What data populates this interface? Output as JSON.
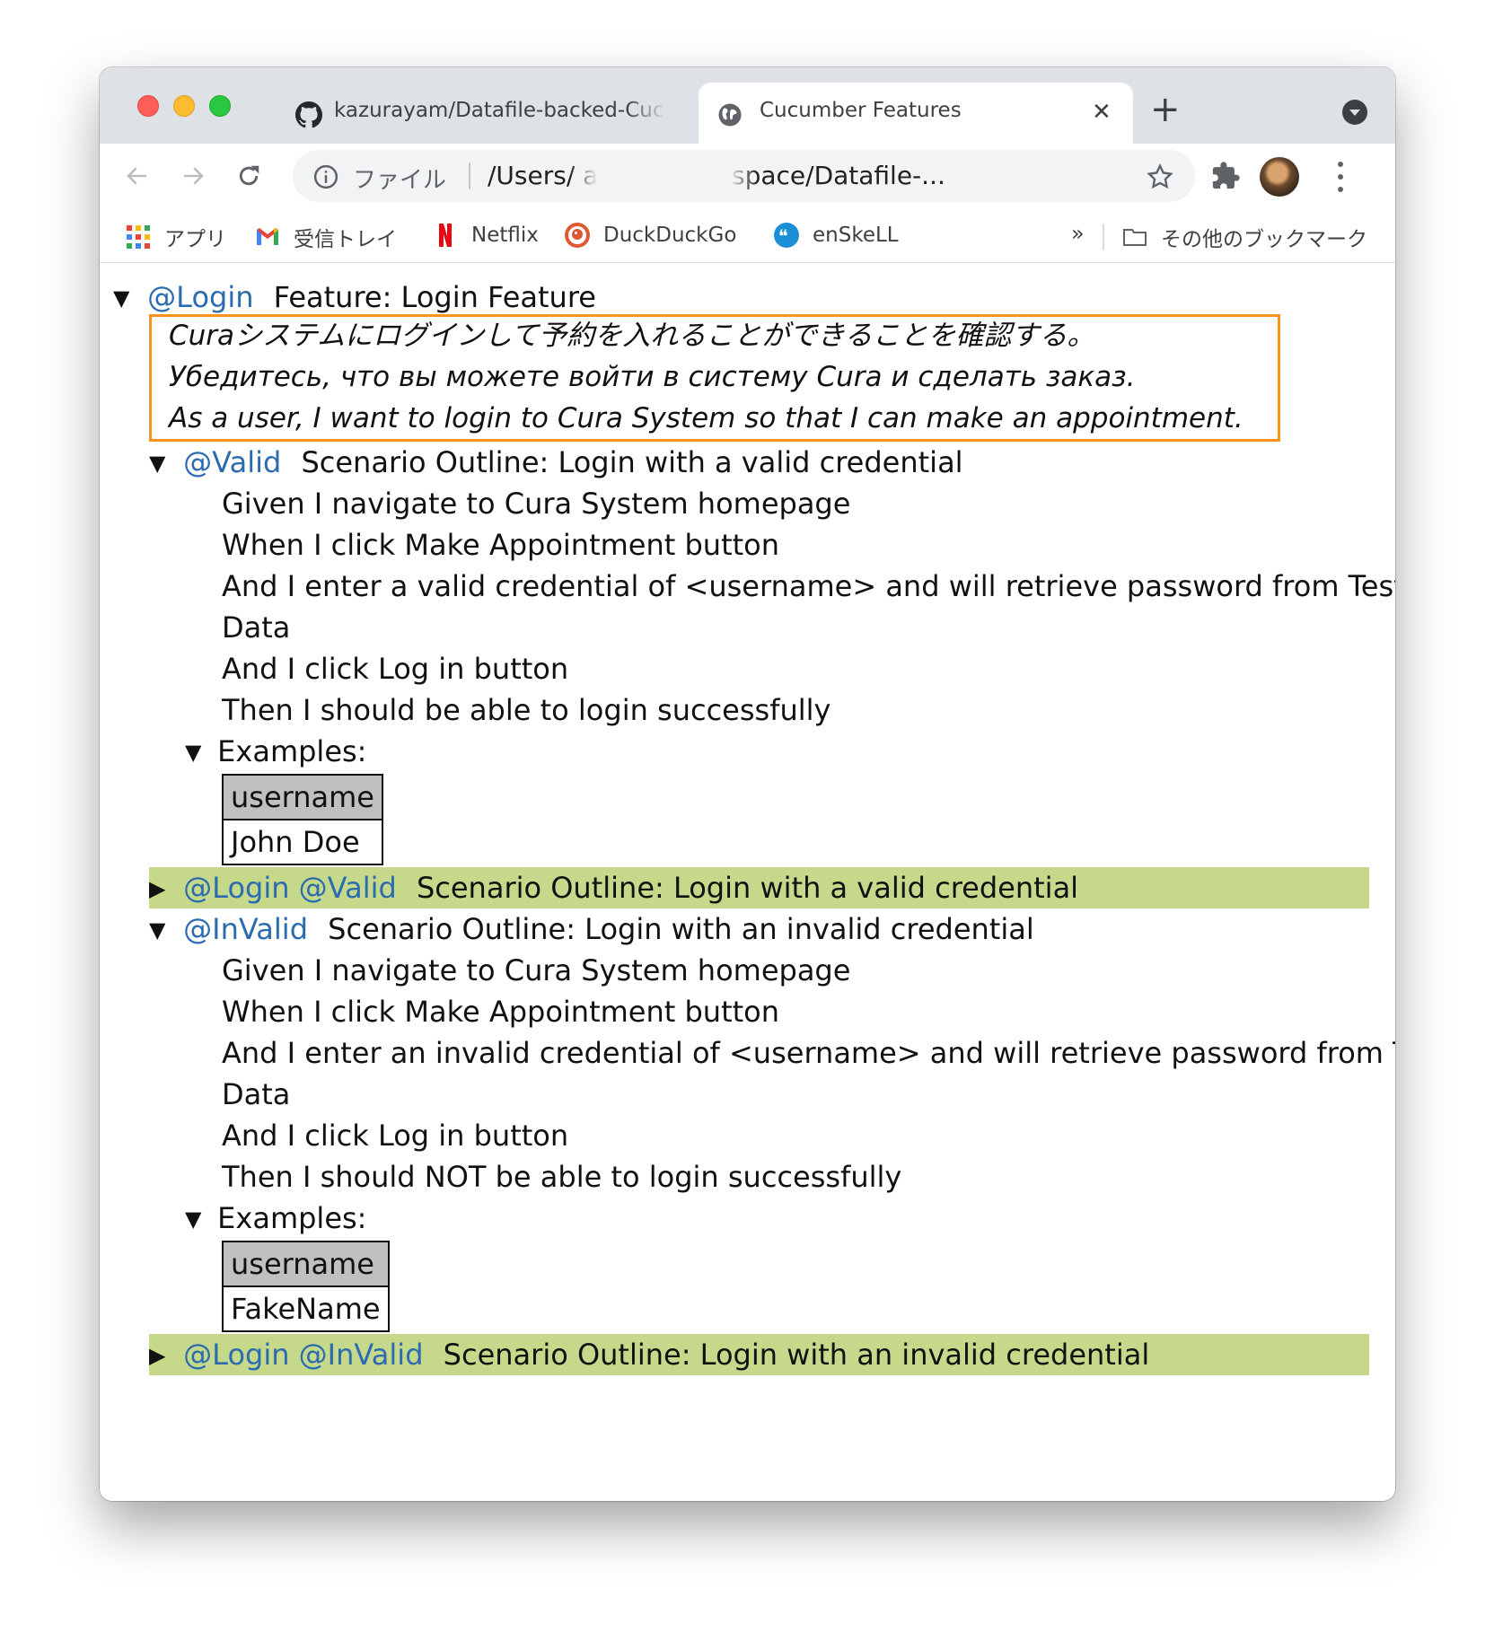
{
  "browser": {
    "tabs": [
      {
        "title": "kazurayam/Datafile-backed-Cucumber",
        "active": false,
        "favicon": "github-icon"
      },
      {
        "title": "Cucumber Features",
        "active": true,
        "favicon": "globe-icon"
      }
    ],
    "new_tab_label": "+",
    "omnibox": {
      "scheme_label": "ファイル",
      "url": "/Users/                              atalon-workspace/Datafile-..."
    },
    "bookmarks": [
      {
        "label": "アプリ",
        "icon": "apps-grid-icon"
      },
      {
        "label": "受信トレイ",
        "icon": "gmail-icon"
      },
      {
        "label": "Netflix",
        "icon": "netflix-icon"
      },
      {
        "label": "DuckDuckGo",
        "icon": "duckduckgo-icon"
      },
      {
        "label": "enSkeLL",
        "icon": "enskell-icon"
      }
    ],
    "bookmarks_overflow": "»",
    "other_bookmarks": "その他のブックマーク",
    "colors": {
      "tab_strip": "#dee1e6",
      "tag_blue": "#2b6cb0",
      "description_border": "#f7931e",
      "result_highlight": "#c6d98b",
      "table_header": "#c0c0c0"
    }
  },
  "feature": {
    "toggle": "▼",
    "tag": "@Login",
    "title": "Feature: Login Feature",
    "description": [
      "Curaシステムにログインして予約を入れることができることを確認する。",
      "Убедитесь, что вы можете войти в систему Cura и сделать заказ.",
      "As a user, I want to login to Cura System so that I can make an appointment."
    ],
    "scenarios": [
      {
        "toggle": "▼",
        "tag": "@Valid",
        "title": "Scenario Outline: Login with a valid credential",
        "steps": [
          "Given I navigate to Cura System homepage",
          "When I click Make Appointment button",
          "And I enter a valid credential of <username> and will retrieve password from Test",
          "Data",
          "And I click Log in button",
          "Then I should be able to login successfully"
        ],
        "examples": {
          "toggle": "▼",
          "label": "Examples:",
          "header": "username",
          "value": "John Doe"
        },
        "result": {
          "toggle": "▶",
          "tags": "@Login @Valid",
          "title": "Scenario Outline: Login with a valid credential"
        }
      },
      {
        "toggle": "▼",
        "tag": "@InValid",
        "title": "Scenario Outline: Login with an invalid credential",
        "steps": [
          "Given I navigate to Cura System homepage",
          "When I click Make Appointment button",
          "And I enter an invalid credential of <username> and will retrieve password from Test",
          "Data",
          "And I click Log in button",
          "Then I should NOT be able to login successfully"
        ],
        "examples": {
          "toggle": "▼",
          "label": "Examples:",
          "header": "username",
          "value": "FakeName"
        },
        "result": {
          "toggle": "▶",
          "tags": "@Login @InValid",
          "title": "Scenario Outline: Login with an invalid credential"
        }
      }
    ]
  }
}
